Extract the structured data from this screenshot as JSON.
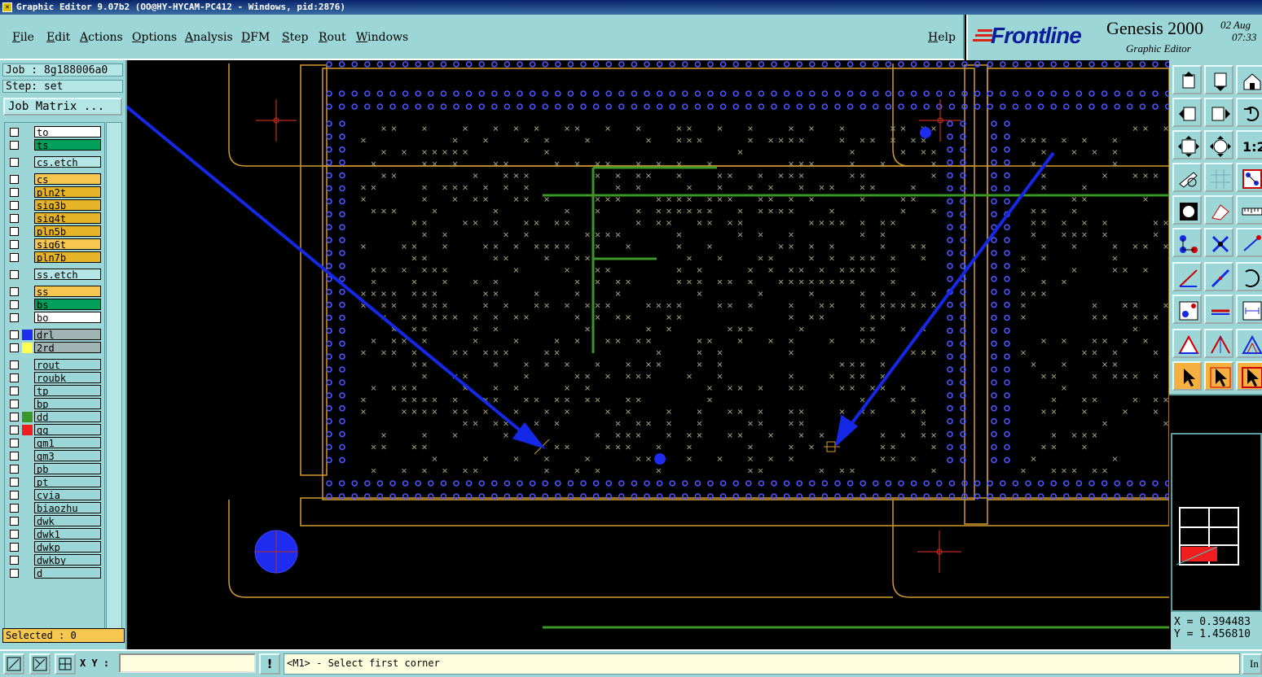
{
  "window": {
    "title": "Graphic Editor 9.07b2 (OO@HY-HYCAM-PC412 - Windows, pid:2876)"
  },
  "menu": [
    {
      "label": "File",
      "id": "file"
    },
    {
      "label": "Edit",
      "id": "edit"
    },
    {
      "label": "Actions",
      "id": "actions"
    },
    {
      "label": "Options",
      "id": "options"
    },
    {
      "label": "Analysis",
      "id": "analysis"
    },
    {
      "label": "DFM",
      "id": "dfm"
    },
    {
      "label": "Step",
      "id": "step"
    },
    {
      "label": "Rout",
      "id": "rout"
    },
    {
      "label": "Windows",
      "id": "windows"
    }
  ],
  "help_label": "Help",
  "logo": {
    "brand": "Frontline",
    "product": "Genesis 2000",
    "subtitle": "Graphic Editor",
    "date": "02 Aug",
    "time": "07:33"
  },
  "job": {
    "job_text": "Job : 8g188006a0",
    "step_text": "Step: set",
    "matrix_label": "Job Matrix ..."
  },
  "layers": [
    {
      "name": "to",
      "color": "#ffffff"
    },
    {
      "name": "ts",
      "color": "#00a05a"
    },
    {
      "name": "cs.etch",
      "color": "#b4e6e6"
    },
    {
      "name": "cs",
      "color": "#f5c650"
    },
    {
      "name": "pln2t",
      "color": "#e6b428"
    },
    {
      "name": "sig3b",
      "color": "#e6b428"
    },
    {
      "name": "sig4t",
      "color": "#e6b428"
    },
    {
      "name": "pln5b",
      "color": "#e6b428"
    },
    {
      "name": "sig6t",
      "color": "#f5c650"
    },
    {
      "name": "pln7b",
      "color": "#e6b428"
    },
    {
      "name": "ss.etch",
      "color": "#b4e6e6"
    },
    {
      "name": "ss",
      "color": "#f5c650"
    },
    {
      "name": "bs",
      "color": "#00a05a"
    },
    {
      "name": "bo",
      "color": "#ffffff"
    },
    {
      "name": "drl",
      "color": "#a0b4b4",
      "swatch": "#1e2cf0"
    },
    {
      "name": "2rd",
      "color": "#a0b4b4",
      "swatch": "#ffff50"
    },
    {
      "name": "rout",
      "color": "#9cd6d6"
    },
    {
      "name": "roubk",
      "color": "#9cd6d6"
    },
    {
      "name": "tp",
      "color": "#9cd6d6"
    },
    {
      "name": "bp",
      "color": "#9cd6d6"
    },
    {
      "name": "dd",
      "color": "#9cd6d6",
      "swatch": "#3c9628"
    },
    {
      "name": "gg",
      "color": "#9cd6d6",
      "swatch": "#f01e1e"
    },
    {
      "name": "gm1",
      "color": "#9cd6d6"
    },
    {
      "name": "gm3",
      "color": "#9cd6d6"
    },
    {
      "name": "pb",
      "color": "#9cd6d6"
    },
    {
      "name": "pt",
      "color": "#9cd6d6"
    },
    {
      "name": "cvia",
      "color": "#9cd6d6"
    },
    {
      "name": "biaozhu",
      "color": "#9cd6d6"
    },
    {
      "name": "dwk",
      "color": "#9cd6d6"
    },
    {
      "name": "dwk1",
      "color": "#9cd6d6"
    },
    {
      "name": "dwkp",
      "color": "#9cd6d6"
    },
    {
      "name": "dwkby",
      "color": "#9cd6d6"
    },
    {
      "name": "d",
      "color": "#9cd6d6"
    }
  ],
  "selected_text": "Selected : 0",
  "coords": {
    "x": "X = 0.394483",
    "y": "Y = 1.456810"
  },
  "bottom": {
    "xy_label": "X Y :",
    "xy_value": "",
    "warn_label": "!",
    "prompt": "<M1> - Select first corner",
    "in_label": "In"
  },
  "toolbar_icons": [
    "page-up-icon",
    "page-down-icon",
    "home-icon",
    "pan-left-icon",
    "pan-right-icon",
    "undo-view-icon",
    "fit-screen-icon",
    "zoom-center-icon",
    "one-to-one-icon",
    "measure-icon",
    "grid-icon",
    "snap-icon",
    "camera-icon",
    "dimension-icon",
    "ruler-icon",
    "connect-icon",
    "cross-icon",
    "vector-icon",
    "line-icon",
    "slash-icon",
    "arc-icon",
    "point-icon",
    "segment-icon",
    "distance-icon",
    "triangle-icon",
    "apex-icon",
    "frame-icon",
    "select-arrow-icon",
    "select-box-icon",
    "select-touch-icon"
  ]
}
